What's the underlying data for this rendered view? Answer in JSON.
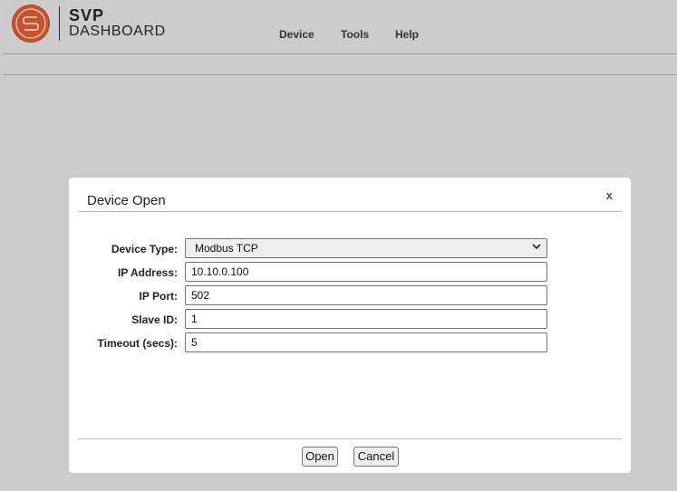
{
  "header": {
    "logo_title": "SVP",
    "logo_subtitle": "DASHBOARD",
    "nav": {
      "device": "Device",
      "tools": "Tools",
      "help": "Help"
    }
  },
  "colors": {
    "brand": "#c8512f",
    "background": "#cccccc",
    "dialog_bg": "#ffffff"
  },
  "dialog": {
    "title": "Device Open",
    "close_label": "x",
    "fields": {
      "device_type": {
        "label": "Device Type:",
        "value": "Modbus TCP"
      },
      "ip_address": {
        "label": "IP Address:",
        "value": "10.10.0.100"
      },
      "ip_port": {
        "label": "IP Port:",
        "value": "502"
      },
      "slave_id": {
        "label": "Slave ID:",
        "value": "1"
      },
      "timeout": {
        "label": "Timeout (secs):",
        "value": "5"
      }
    },
    "buttons": {
      "open": "Open",
      "cancel": "Cancel"
    }
  }
}
